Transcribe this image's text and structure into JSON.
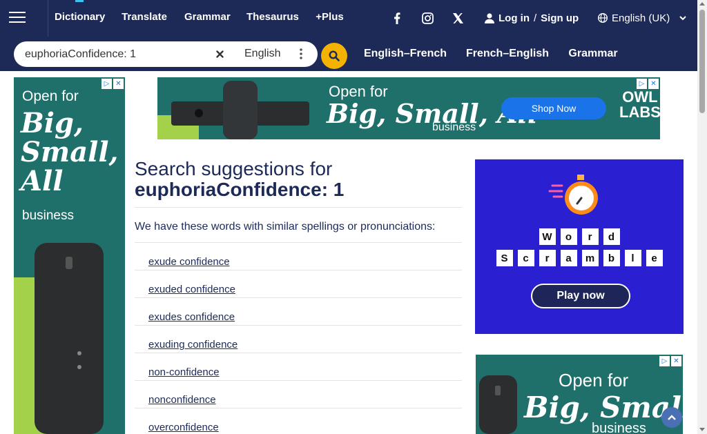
{
  "header": {
    "nav": [
      {
        "label": "Dictionary",
        "active": true
      },
      {
        "label": "Translate"
      },
      {
        "label": "Grammar"
      },
      {
        "label": "Thesaurus"
      },
      {
        "label": "+Plus"
      }
    ],
    "social": [
      "facebook-icon",
      "instagram-icon",
      "x-icon"
    ],
    "login": "Log in",
    "slash": "/",
    "signup": "Sign up",
    "language": "English (UK)"
  },
  "search": {
    "value": "euphoriaConfidence: 1",
    "dictionary": "English",
    "tabs": [
      "English–French",
      "French–English",
      "Grammar"
    ]
  },
  "ads": {
    "owl": {
      "headline": "Open for",
      "big_line1": "Big,",
      "big_line2": "Small,",
      "big_line3": "All",
      "big_inline": "Big, Small, All",
      "business": "business",
      "shop_now": "Shop Now",
      "logo_line1": "OWL",
      "logo_line2": "LABS"
    },
    "word_scramble": {
      "row1": [
        "W",
        "o",
        "r",
        "d"
      ],
      "row2": [
        "S",
        "c",
        "r",
        "a",
        "m",
        "b",
        "l",
        "e"
      ],
      "play": "Play now"
    }
  },
  "main": {
    "heading": "Search suggestions for",
    "term": "euphoriaConfidence: 1",
    "intro": "We have these words with similar spellings or pronunciations:",
    "suggestions": [
      "exude confidence",
      "exuded confidence",
      "exudes confidence",
      "exuding confidence",
      "non-confidence",
      "nonconfidence",
      "overconfidence"
    ]
  },
  "colors": {
    "header_bg": "#1d2a57",
    "accent_yellow": "#f5b301",
    "ad_green": "#1f6f6b",
    "ad_blue": "#2a1fd1"
  }
}
